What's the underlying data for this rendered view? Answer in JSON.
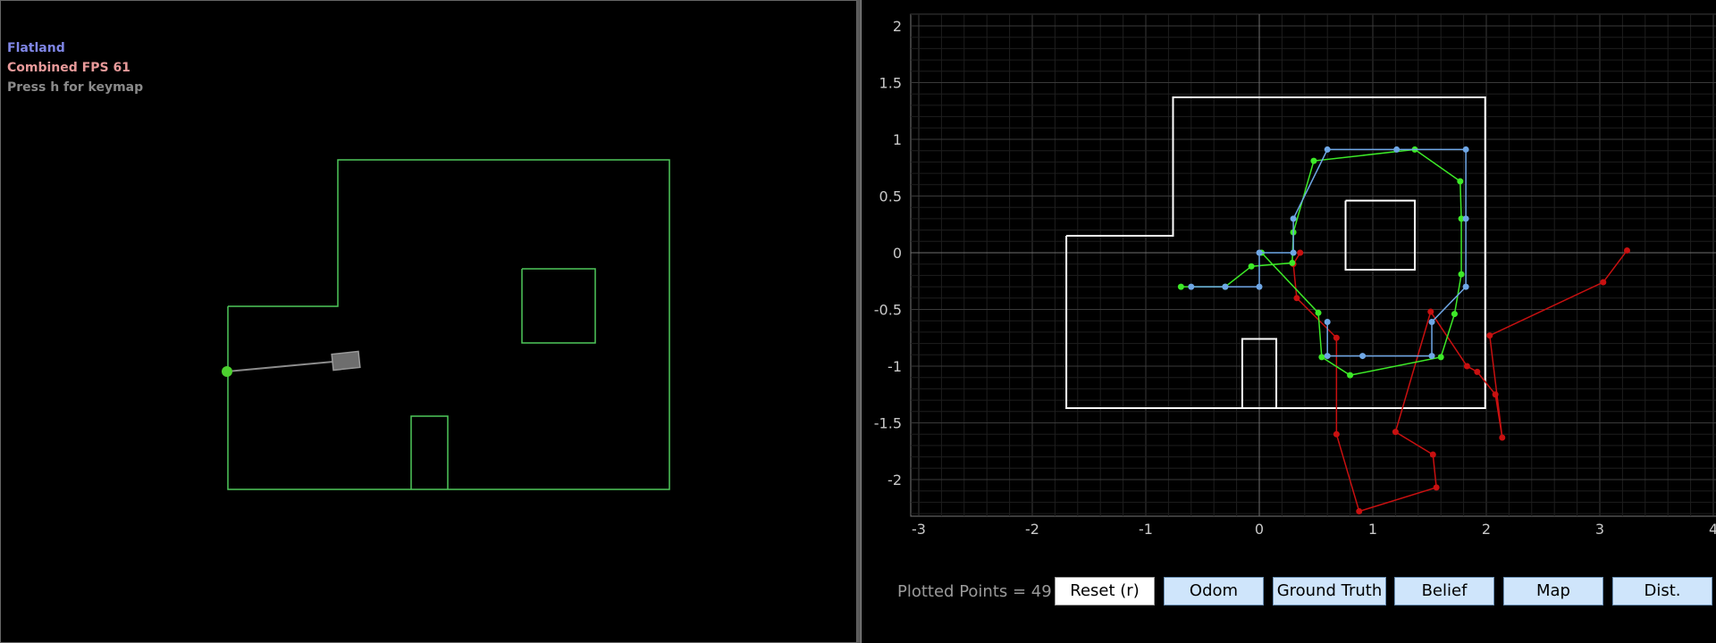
{
  "simulator": {
    "title": "Flatland",
    "fps_text": "Combined FPS 61",
    "help_text": "Press h for keymap"
  },
  "plotter": {
    "plotted_points_label": "Plotted Points = 49",
    "buttons": {
      "reset": "Reset (r)",
      "odom": "Odom",
      "ground_truth": "Ground Truth",
      "belief": "Belief",
      "map": "Map",
      "dist": "Dist."
    },
    "colors": {
      "ground_truth": "#3dea28",
      "belief": "#6fa7e6",
      "odom": "#c81010",
      "map": "#ffffff"
    }
  },
  "chart_data": {
    "type": "scatter",
    "title": "",
    "xlabel": "",
    "ylabel": "",
    "xlim": [
      -3,
      4
    ],
    "ylim": [
      -2.3,
      2.1
    ],
    "x_ticks": [
      "-3",
      "-2",
      "-1",
      "0",
      "1",
      "2",
      "3",
      "4"
    ],
    "y_ticks": [
      "2",
      "1.5",
      "1",
      "0.5",
      "0",
      "-0.5",
      "-1",
      "-1.5",
      "-2"
    ],
    "grid": true,
    "map_polylines": [
      [
        [
          -1.7,
          0.15
        ],
        [
          -0.76,
          0.15
        ],
        [
          -0.76,
          1.37
        ],
        [
          1.99,
          1.37
        ],
        [
          1.99,
          -1.37
        ],
        [
          -1.7,
          -1.37
        ],
        [
          -1.7,
          0.15
        ]
      ],
      [
        [
          0.76,
          0.46
        ],
        [
          1.37,
          0.46
        ],
        [
          1.37,
          -0.15
        ],
        [
          0.76,
          -0.15
        ],
        [
          0.76,
          0.46
        ]
      ],
      [
        [
          -0.15,
          -1.37
        ],
        [
          -0.15,
          -0.76
        ],
        [
          0.15,
          -0.76
        ],
        [
          0.15,
          -1.37
        ]
      ]
    ],
    "series": [
      {
        "key": "odom",
        "points": [
          [
            0.36,
            0.0
          ],
          [
            0.3,
            -0.1
          ],
          [
            0.33,
            -0.4
          ],
          [
            0.68,
            -0.75
          ],
          [
            0.68,
            -1.6
          ],
          [
            0.88,
            -2.28
          ],
          [
            1.56,
            -2.07
          ],
          [
            1.53,
            -1.78
          ],
          [
            1.2,
            -1.58
          ],
          [
            1.51,
            -0.52
          ],
          [
            1.83,
            -1.0
          ],
          [
            1.92,
            -1.05
          ],
          [
            2.08,
            -1.25
          ],
          [
            2.14,
            -1.63
          ],
          [
            2.03,
            -0.73
          ],
          [
            3.03,
            -0.26
          ],
          [
            3.24,
            0.02
          ]
        ]
      },
      {
        "key": "ground_truth",
        "points": [
          [
            -0.69,
            -0.3
          ],
          [
            -0.3,
            -0.3
          ],
          [
            -0.07,
            -0.12
          ],
          [
            0.29,
            -0.09
          ],
          [
            0.3,
            0.18
          ],
          [
            0.48,
            0.81
          ],
          [
            1.37,
            0.91
          ],
          [
            1.77,
            0.63
          ],
          [
            1.78,
            0.3
          ],
          [
            1.78,
            -0.19
          ],
          [
            1.72,
            -0.54
          ],
          [
            1.6,
            -0.92
          ],
          [
            0.8,
            -1.08
          ],
          [
            0.55,
            -0.92
          ],
          [
            0.52,
            -0.53
          ],
          [
            0.02,
            0.0
          ]
        ]
      },
      {
        "key": "belief",
        "points": [
          [
            -0.6,
            -0.3
          ],
          [
            -0.3,
            -0.3
          ],
          [
            0.0,
            -0.3
          ],
          [
            0.0,
            0.0
          ],
          [
            0.3,
            0.0
          ],
          [
            0.3,
            0.3
          ],
          [
            0.6,
            0.91
          ],
          [
            1.21,
            0.91
          ],
          [
            1.82,
            0.91
          ],
          [
            1.82,
            0.3
          ],
          [
            1.82,
            -0.3
          ],
          [
            1.52,
            -0.61
          ],
          [
            1.52,
            -0.91
          ],
          [
            0.91,
            -0.91
          ],
          [
            0.6,
            -0.91
          ],
          [
            0.6,
            -0.61
          ]
        ]
      }
    ]
  },
  "world": {
    "walls": [
      [
        [
          254,
          342
        ],
        [
          377,
          342
        ],
        [
          377,
          178
        ],
        [
          748,
          178
        ],
        [
          748,
          547
        ],
        [
          254,
          547
        ],
        [
          254,
          342
        ]
      ],
      [
        [
          583,
          300
        ],
        [
          665,
          300
        ],
        [
          665,
          383
        ],
        [
          583,
          383
        ],
        [
          583,
          300
        ]
      ],
      [
        [
          459,
          547
        ],
        [
          459,
          465
        ],
        [
          500,
          465
        ],
        [
          500,
          547
        ]
      ]
    ],
    "robot": {
      "heading_deg": -6
    },
    "sensor_hit": [
      253,
      415
    ],
    "ray_origin": [
      372,
      404
    ]
  }
}
